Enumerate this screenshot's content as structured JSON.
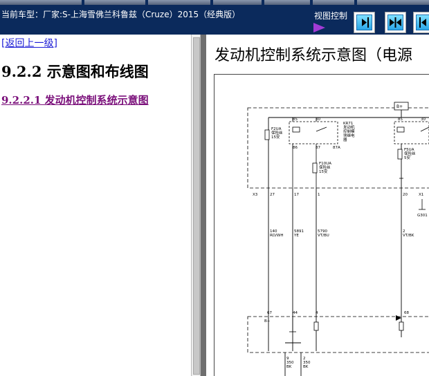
{
  "header": {
    "vehicle_label": "当前车型：厂家:S-上海雪佛兰科鲁兹（Cruze）2015（经典版）",
    "view_control_label": "视图控制"
  },
  "icons": {
    "view_arrow": "triangle-right-icon",
    "view_btn_1": "collapse-left-pane-icon",
    "view_btn_2": "split-both-panes-icon",
    "view_btn_3": "collapse-right-pane-icon"
  },
  "nav": {
    "back_link": "[返回上一级]",
    "section_title": "9.2.2 示意图和布线图",
    "subsection_link": "9.2.2.1 发动机控制系统示意图"
  },
  "document": {
    "title": "发动机控制系统示意图（电源"
  },
  "diagram": {
    "battery": "B+",
    "relay_id": "KR71",
    "relay_desc": [
      "发动机",
      "控制模",
      "块继电",
      "器"
    ],
    "fuse_left": [
      "F2UA",
      "保险丝",
      "15安"
    ],
    "fuse_mid": [
      "F10UA",
      "保险丝",
      "15安"
    ],
    "fuse_right": [
      "F5UA",
      "保险丝",
      "5安"
    ],
    "pins_top": [
      "85",
      "30",
      "86",
      "87",
      "87A",
      "85",
      "30"
    ],
    "connector": "X3",
    "connector_pins": [
      "27",
      "17",
      "1",
      "20",
      "X1"
    ],
    "wires": [
      {
        "num": "140",
        "color": "RD/WH"
      },
      {
        "num": "5891",
        "color": "YE"
      },
      {
        "num": "5790",
        "color": "VT/BU"
      },
      {
        "num": "2",
        "color": "VT/BK"
      }
    ],
    "ground": "G301",
    "module_pins": [
      "67",
      "44",
      "4",
      "68"
    ],
    "module_label": "B+",
    "bottom_wires": [
      {
        "num": "9",
        "size": "350",
        "color": "BK"
      },
      {
        "num": "2",
        "size": "350",
        "color": "BK"
      }
    ]
  }
}
